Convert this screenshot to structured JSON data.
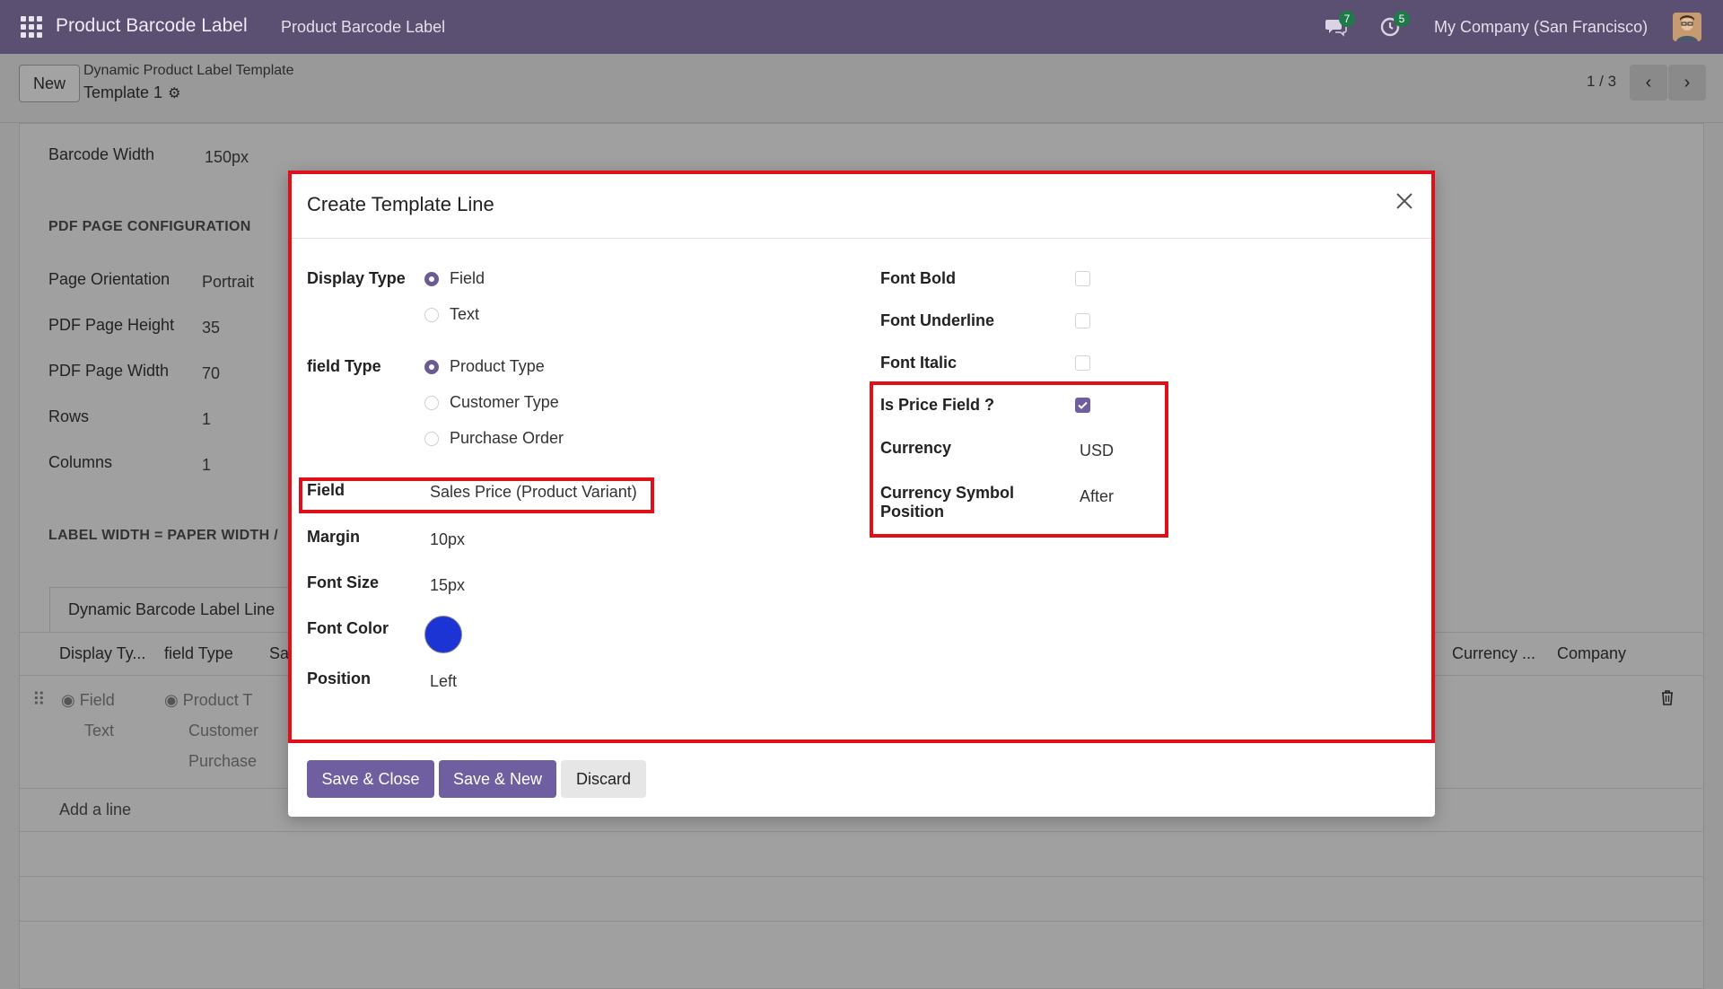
{
  "navbar": {
    "app_name": "Product Barcode Label",
    "menu_item": "Product Barcode Label",
    "messages_count": "7",
    "activities_count": "5",
    "company": "My Company (San Francisco)"
  },
  "control_panel": {
    "new_label": "New",
    "breadcrumb_parent": "Dynamic Product Label Template",
    "breadcrumb_current": "Template 1",
    "pager": "1 / 3"
  },
  "background_form": {
    "barcode_width_label": "Barcode Width",
    "barcode_width_value": "150px",
    "pdf_section": "PDF PAGE CONFIGURATION",
    "page_orientation_label": "Page Orientation",
    "page_orientation_value": "Portrait",
    "pdf_height_label": "PDF Page Height",
    "pdf_height_value": "35",
    "pdf_width_label": "PDF Page Width",
    "pdf_width_value": "70",
    "rows_label": "Rows",
    "rows_value": "1",
    "columns_label": "Columns",
    "columns_value": "1",
    "label_width_section": "LABEL WIDTH = PAPER WIDTH /",
    "tab_label": "Dynamic Barcode Label Line",
    "columns_header": {
      "display_type": "Display Ty...",
      "field_type": "field Type",
      "sa": "Sa",
      "currency": "Currency ...",
      "company": "Company"
    },
    "row": {
      "display_field": "Field",
      "display_text": "Text",
      "type_product": "Product T",
      "type_customer": "Customer",
      "type_purchase": "Purchase"
    },
    "add_line": "Add a line"
  },
  "modal": {
    "title": "Create Template Line",
    "display_type_label": "Display Type",
    "display_type_options": [
      "Field",
      "Text"
    ],
    "display_type_selected": "Field",
    "field_type_label": "field Type",
    "field_type_options": [
      "Product Type",
      "Customer Type",
      "Purchase Order"
    ],
    "field_type_selected": "Product Type",
    "field_label": "Field",
    "field_value": "Sales Price (Product Variant)",
    "margin_label": "Margin",
    "margin_value": "10px",
    "font_size_label": "Font Size",
    "font_size_value": "15px",
    "font_color_label": "Font Color",
    "font_color_value": "#1d34d4",
    "position_label": "Position",
    "position_value": "Left",
    "font_bold_label": "Font Bold",
    "font_bold_checked": false,
    "font_underline_label": "Font Underline",
    "font_underline_checked": false,
    "font_italic_label": "Font Italic",
    "font_italic_checked": false,
    "is_price_label": "Is Price Field ?",
    "is_price_checked": true,
    "currency_label": "Currency",
    "currency_value": "USD",
    "currency_symbol_label_line1": "Currency Symbol",
    "currency_symbol_label_line2": "Position",
    "currency_symbol_value": "After",
    "buttons": {
      "save_close": "Save & Close",
      "save_new": "Save & New",
      "discard": "Discard"
    }
  },
  "colors": {
    "navbar": "#5b4f72",
    "primary": "#6f5ea0",
    "highlight": "#e0101b"
  }
}
